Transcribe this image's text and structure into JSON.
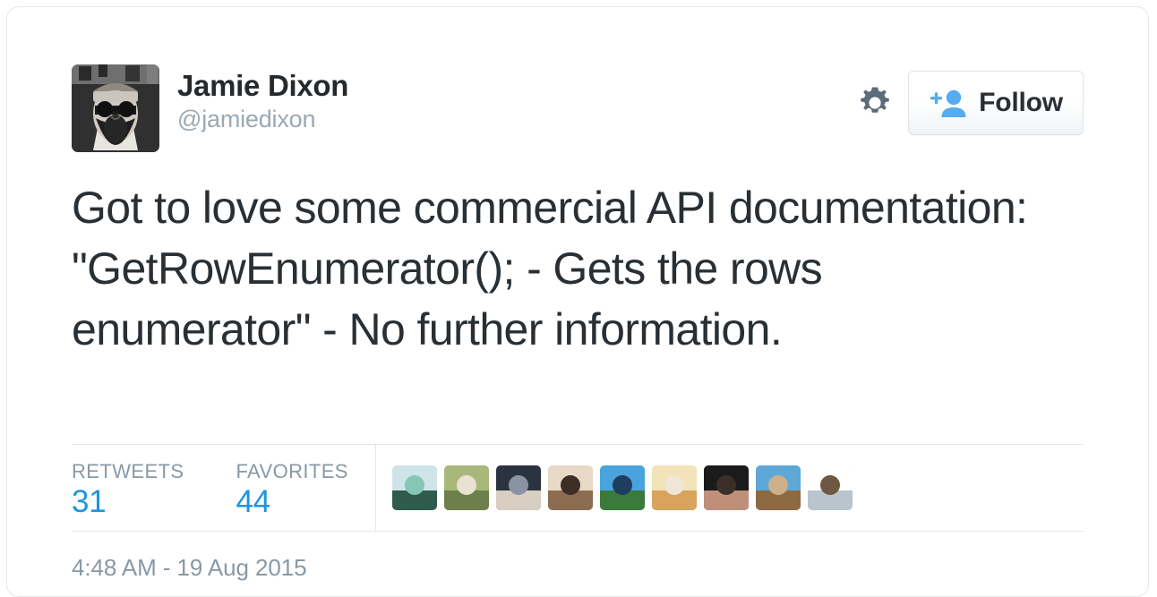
{
  "card": {
    "accent_blue": "#1b95e0",
    "text_color": "#292f33",
    "muted_color": "#8899a6",
    "border_color": "#e1e8ed"
  },
  "author": {
    "display_name": "Jamie Dixon",
    "handle": "@jamiedixon",
    "avatar_alt": "avatar-photo-bearded-man-sunglasses"
  },
  "actions": {
    "settings_icon": "gear-icon",
    "follow_label": "Follow",
    "follow_icon": "add-person-icon"
  },
  "tweet": {
    "text": "Got to love some commercial API documentation: \"GetRowEnumerator(); - Gets the rows enumerator\" - No further information.",
    "timestamp": "4:48 AM - 19 Aug 2015"
  },
  "stats": {
    "retweets_label": "RETWEETS",
    "retweets_value": "31",
    "favorites_label": "FAVORITES",
    "favorites_value": "44"
  },
  "facepile": [
    {
      "name": "engager-avatar-1",
      "colors": [
        "#cfe4e8",
        "#2f5a4c",
        "#86c6b6"
      ]
    },
    {
      "name": "engager-avatar-2",
      "colors": [
        "#a8b87a",
        "#6d7f4a",
        "#e7e2d2"
      ]
    },
    {
      "name": "engager-avatar-3",
      "colors": [
        "#2b3340",
        "#d8cfc2",
        "#8a93a3"
      ]
    },
    {
      "name": "engager-avatar-4",
      "colors": [
        "#e8d9c7",
        "#8c6c51",
        "#3d2f26"
      ]
    },
    {
      "name": "engager-avatar-5",
      "colors": [
        "#4aa3dd",
        "#3b7a3c",
        "#1f3d5c"
      ]
    },
    {
      "name": "engager-avatar-6",
      "colors": [
        "#f2e3b8",
        "#d8a35c",
        "#efe6d6"
      ]
    },
    {
      "name": "engager-avatar-7",
      "colors": [
        "#1b1b1b",
        "#c08f7a",
        "#3a3029"
      ]
    },
    {
      "name": "engager-avatar-8",
      "colors": [
        "#5ea8d8",
        "#8d6a42",
        "#cdb089"
      ]
    },
    {
      "name": "engager-avatar-9",
      "colors": [
        "#ffffff",
        "#b9c4cc",
        "#6e5842"
      ]
    }
  ]
}
